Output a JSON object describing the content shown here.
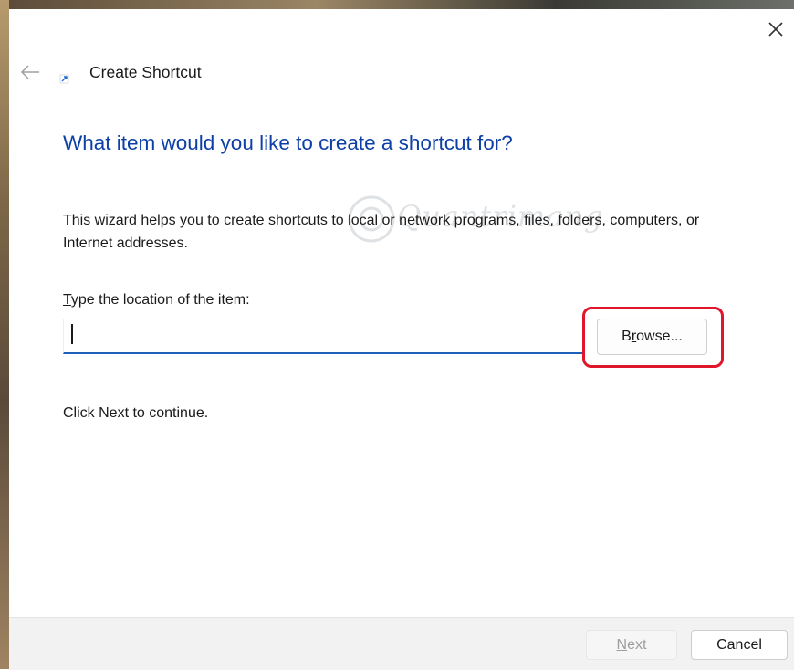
{
  "window": {
    "title": "Create Shortcut"
  },
  "header": {
    "back_icon": "back-arrow-icon",
    "close_icon": "close-icon",
    "app_icon": "shortcut-arrow-icon"
  },
  "main": {
    "heading": "What item would you like to create a shortcut for?",
    "description": "This wizard helps you to create shortcuts to local or network programs, files, folders, computers, or Internet addresses.",
    "location": {
      "label_mnemonic": "T",
      "label_rest": "ype the location of the item:",
      "value": "",
      "placeholder": ""
    },
    "browse": {
      "mnemonic_pre": "B",
      "mnemonic": "r",
      "label_rest": "owse..."
    },
    "hint": "Click Next to continue."
  },
  "footer": {
    "next": {
      "mnemonic": "N",
      "label_rest": "ext",
      "enabled": false
    },
    "cancel_label": "Cancel"
  },
  "watermark": {
    "text": "Quantrimang"
  },
  "colors": {
    "heading": "#0d3fa6",
    "input_underline": "#1e5fb8",
    "highlight": "#e0162b",
    "footer_bg": "#f2f2f2"
  }
}
